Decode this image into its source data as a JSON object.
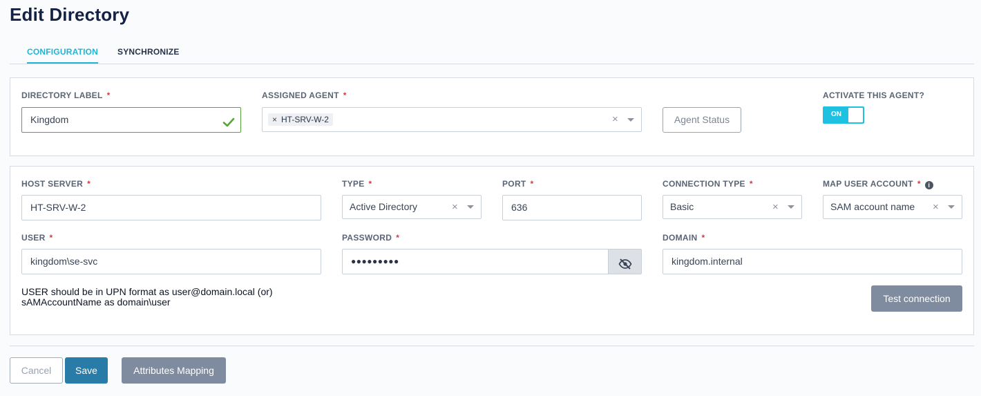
{
  "page": {
    "title": "Edit Directory"
  },
  "tabs": [
    {
      "label": "CONFIGURATION",
      "active": true
    },
    {
      "label": "SYNCHRONIZE",
      "active": false
    }
  ],
  "agent_card": {
    "directory_label": {
      "label": "DIRECTORY LABEL",
      "required": "*",
      "value": "Kingdom",
      "valid": true
    },
    "assigned_agent": {
      "label": "ASSIGNED AGENT",
      "required": "*",
      "chip": "HT-SRV-W-2",
      "chip_remove": "×",
      "clear": "×"
    },
    "agent_status_button": "Agent Status",
    "activate": {
      "label": "ACTIVATE THIS AGENT?",
      "toggle_text": "ON",
      "on": true
    }
  },
  "connection_card": {
    "host_server": {
      "label": "HOST SERVER",
      "required": "*",
      "value": "HT-SRV-W-2"
    },
    "type": {
      "label": "TYPE",
      "required": "*",
      "value": "Active Directory",
      "clear": "×"
    },
    "port": {
      "label": "PORT",
      "required": "*",
      "value": "636"
    },
    "connection_type": {
      "label": "CONNECTION TYPE",
      "required": "*",
      "value": "Basic",
      "clear": "×"
    },
    "map_user_account": {
      "label": "MAP USER ACCOUNT",
      "required": "*",
      "info": "i",
      "value": "SAM account name",
      "clear": "×"
    },
    "user": {
      "label": "USER",
      "required": "*",
      "value": "kingdom\\se-svc"
    },
    "password": {
      "label": "PASSWORD",
      "required": "*",
      "value": "●●●●●●●●●"
    },
    "domain": {
      "label": "DOMAIN",
      "required": "*",
      "value": "kingdom.internal"
    },
    "helper_line1": "USER should be in UPN format as user@domain.local (or)",
    "helper_line2": "sAMAccountName as domain\\user",
    "test_connection_button": "Test connection"
  },
  "footer": {
    "cancel": "Cancel",
    "save": "Save",
    "attributes_mapping": "Attributes Mapping"
  },
  "colors": {
    "accent": "#1fb5d4",
    "required": "#e0353f",
    "valid": "#5aa33a",
    "save": "#2a7ca8",
    "secondary": "#7f8b9f"
  }
}
